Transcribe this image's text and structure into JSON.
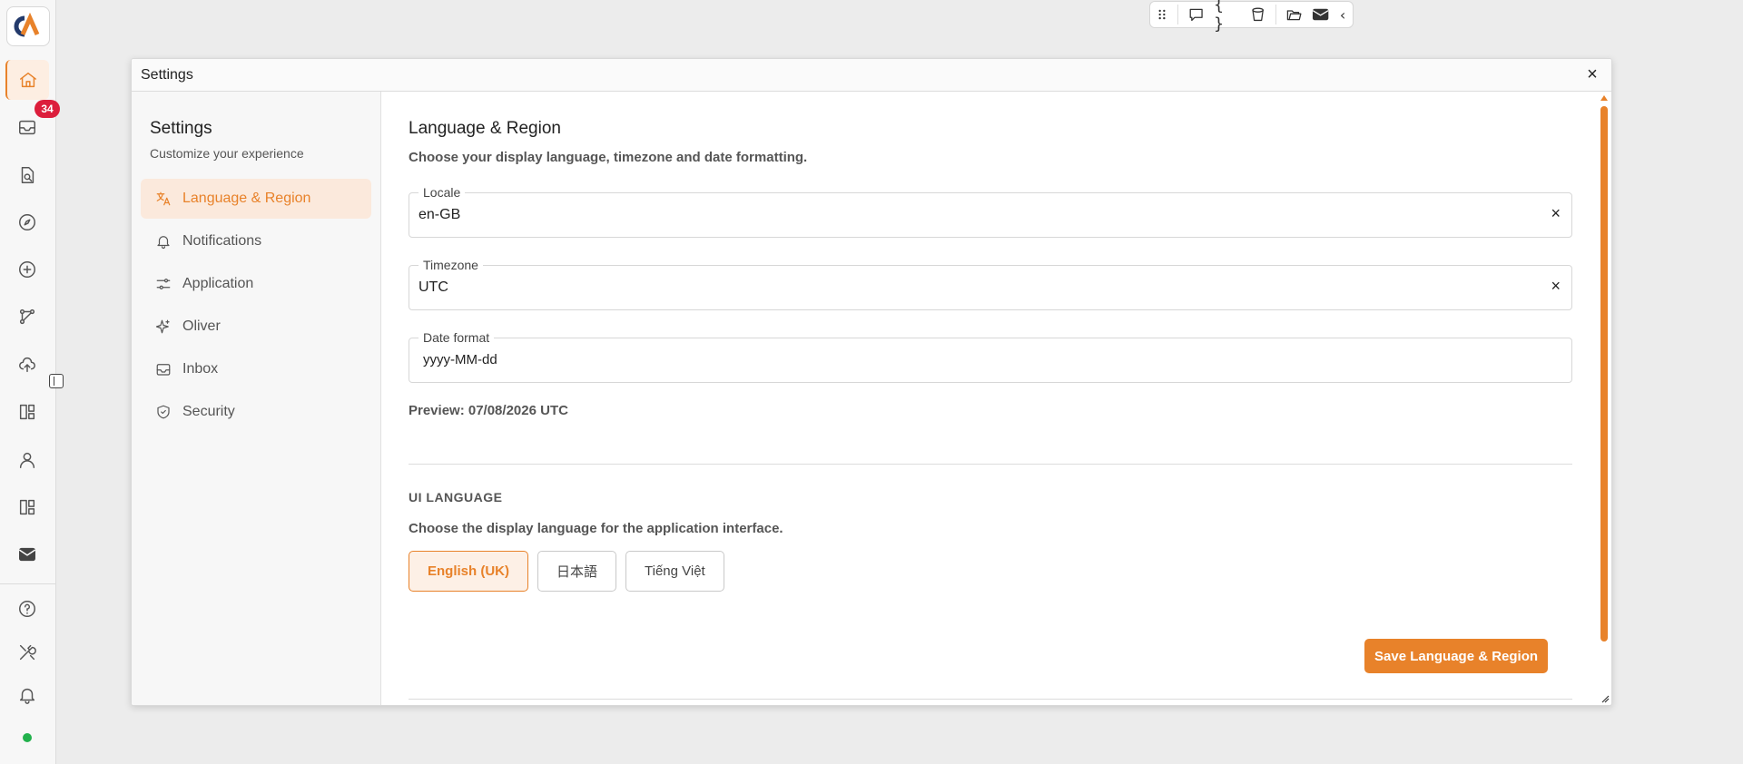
{
  "rail": {
    "badge_count": "34",
    "items": [
      {
        "icon": "home-icon"
      },
      {
        "icon": "inbox-icon"
      },
      {
        "icon": "document-search-icon"
      },
      {
        "icon": "compass-icon"
      },
      {
        "icon": "plus-circle-icon"
      },
      {
        "icon": "workflow-icon"
      },
      {
        "icon": "cloud-upload-icon"
      },
      {
        "icon": "dashboard-icon"
      },
      {
        "icon": "user-icon"
      },
      {
        "icon": "dashboard-alt-icon"
      },
      {
        "icon": "mail-icon"
      },
      {
        "icon": "help-icon"
      },
      {
        "icon": "tools-icon"
      },
      {
        "icon": "bell-icon"
      }
    ],
    "accent": "#e8822a",
    "status_color": "#22b14c"
  },
  "toolbar": {
    "icons": [
      "drag-handle-icon",
      "comment-icon",
      "braces-icon",
      "bucket-icon",
      "folder-icon",
      "mail-icon",
      "chevron-left-icon"
    ],
    "braces_text": "{ }",
    "chevron_text": "‹"
  },
  "modal": {
    "title": "Settings",
    "close": "×"
  },
  "sidebar": {
    "title": "Settings",
    "subtitle": "Customize your experience",
    "items": [
      {
        "label": "Language & Region",
        "icon": "translate-icon",
        "active": true
      },
      {
        "label": "Notifications",
        "icon": "bell-icon"
      },
      {
        "label": "Application",
        "icon": "sliders-icon"
      },
      {
        "label": "Oliver",
        "icon": "sparkle-icon"
      },
      {
        "label": "Inbox",
        "icon": "inbox-icon"
      },
      {
        "label": "Security",
        "icon": "shield-icon"
      }
    ]
  },
  "content": {
    "title": "Language & Region",
    "description": "Choose your display language, timezone and date formatting.",
    "locale": {
      "label": "Locale",
      "value": "en-GB",
      "clear": "×"
    },
    "timezone": {
      "label": "Timezone",
      "value": "UTC",
      "clear": "×"
    },
    "date_format": {
      "label": "Date format",
      "value": "yyyy-MM-dd"
    },
    "preview": "Preview: 07/08/2026 UTC",
    "ui_language": {
      "heading": "UI LANGUAGE",
      "description": "Choose the display language for the application interface.",
      "options": [
        "English (UK)",
        "日本語",
        "Tiếng Việt"
      ],
      "selected": "English (UK)"
    },
    "save_label": "Save Language & Region"
  }
}
